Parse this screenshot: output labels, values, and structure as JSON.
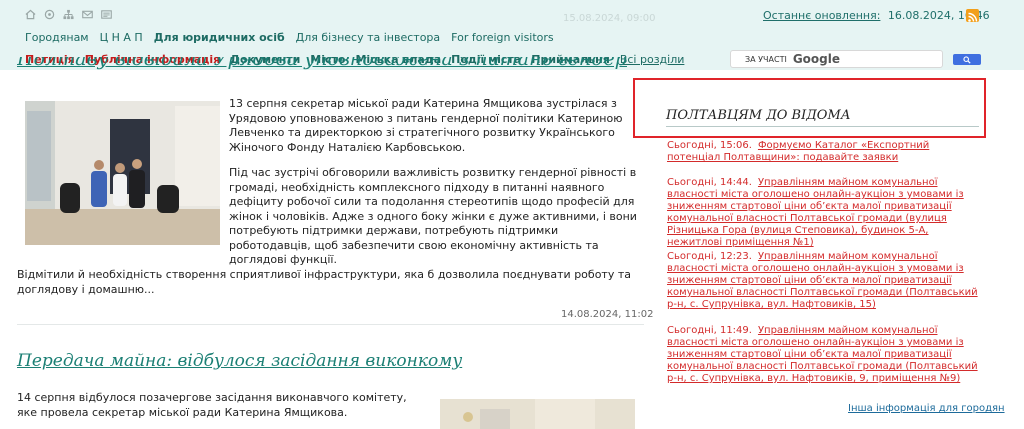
{
  "header": {
    "icons": [
      "home-icon",
      "grid-icon",
      "sitemap-icon",
      "mail-icon",
      "contact-card-icon"
    ],
    "faded_date": "15.08.2024, 09:00",
    "updated_label": "Останнє оновлення:",
    "updated_value": "16.08.2024, 16:46",
    "nav1": [
      "Городянам",
      "Ц Н А П",
      "Для юридичних осіб",
      "Для бізнесу та інвестора",
      "For foreign visitors"
    ],
    "nav2": [
      "Петиція",
      "Публічна інформація",
      "Документи",
      "Місто",
      "Міська влада",
      "Події міста",
      "Приймальня",
      "Всі розділи"
    ],
    "search_prefix": "ЗА УЧАСТІ",
    "search_brand": "Google"
  },
  "article1": {
    "title": "Полтаву відвідала Урядова уповноважена з питань гендерної політики",
    "lead": "13 серпня секретар міської ради Катерина Ямщикова зустрілася з Урядовою уповноваженою з питань гендерної політики Катериною Левченко та директоркою зі стратегічного розвитку Українського Жіночого Фонду Наталією Карбовською.",
    "para2": "Під час зустрічі обговорили важливість розвитку гендерної рівності в громаді, необхідність комплексного підходу в питанні наявного дефіциту робочої сили та подолання стереотипів щодо професій для жінок і чоловіків. Адже з одного боку жінки є дуже активними, і вони потребують підтримки держави, потребують підтримки роботодавців, щоб забезпечити свою економічну активність та доглядові функції.",
    "para3": "Відмітили й необхідність створення сприятливої інфраструктури, яка б дозволила поєднувати роботу та доглядову і домашню...",
    "date": "14.08.2024, 11:02"
  },
  "article2": {
    "title": "Передача майна: відбулося засідання виконкому",
    "lead": "14 серпня відбулося позачергове засідання виконавчого комітету, яке провела секретар міської ради Катерина Ямщикова."
  },
  "news": {
    "heading": "ПОЛТАВЦЯМ ДО ВІДОМА",
    "items": [
      {
        "time": "Сьогодні, 15:06.",
        "text": "Формуємо Каталог «Експортний потенціал Полтавщини»: подавайте заявки"
      },
      {
        "time": "Сьогодні, 14:44.",
        "text": "Управлінням майном комунальної власності міста оголошено онлайн-аукціон з умовами із зниженням стартової ціни об’єкта малої приватизації комунальної власності Полтавської громади (вулиця Різницька Гора (вулиця Степовика), будинок 5-А, нежитлові приміщення №1)"
      },
      {
        "time": "Сьогодні, 12:23.",
        "text": "Управлінням майном комунальної власності міста оголошено онлайн-аукціон з умовами із зниженням стартової ціни об’єкта малої приватизації комунальної власності Полтавської громади (Полтавський р-н, с. Супрунівка, вул. Нафтовиків, 15)"
      },
      {
        "time": "Сьогодні, 11:49.",
        "text": "Управлінням майном комунальної власності міста оголошено онлайн-аукціон з умовами із зниженням стартової ціни об’єкта малої приватизації комунальної власності Полтавської громади (Полтавський р-н, с. Супрунівка, вул. Нафтовиків, 9, приміщення №9)"
      }
    ],
    "other_link": "Інша інформація для городян"
  }
}
